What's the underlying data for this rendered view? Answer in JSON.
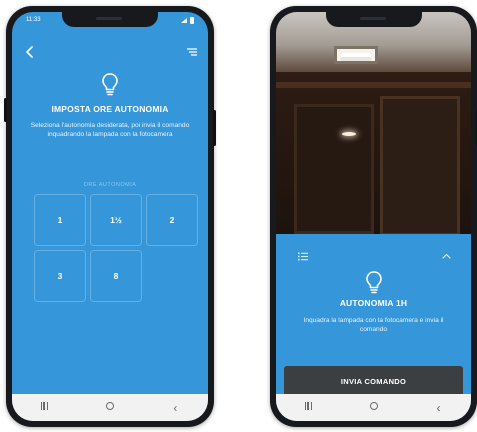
{
  "screen1": {
    "status_time": "11:33",
    "title": "IMPOSTA ORE AUTONOMIA",
    "description": "Seleziona l'autonomia desiderata, poi invia il comando inquadrando la lampada con la fotocamera",
    "section_label": "ORE AUTONOMIA",
    "options": [
      "1",
      "1½",
      "2",
      "3",
      "8"
    ],
    "icons": {
      "back": "chevron-left-icon",
      "menu": "menu-icon",
      "bulb": "lightbulb-icon"
    }
  },
  "screen2": {
    "title": "AUTONOMIA 1H",
    "description": "Inquadra la lampada con la fotocamera e invia il comando",
    "button_label": "INVIA COMANDO",
    "icons": {
      "list": "list-icon",
      "collapse": "chevron-up-icon",
      "bulb": "lightbulb-icon"
    }
  },
  "navbar": {
    "recent": "recent-apps-icon",
    "home": "home-icon",
    "back": "back-icon"
  },
  "colors": {
    "primary": "#3596d9",
    "button_dark": "#3c3f42",
    "navbar": "#f2f2f2",
    "phone_frame": "#17191c"
  }
}
